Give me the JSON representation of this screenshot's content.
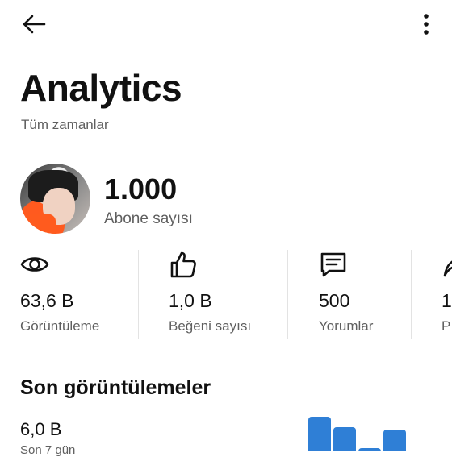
{
  "header": {
    "back_icon": "arrow-left-icon",
    "menu_icon": "more-vertical-icon"
  },
  "page": {
    "title": "Analytics",
    "subtitle": "Tüm zamanlar"
  },
  "channel": {
    "avatar": "profile-avatar",
    "subscriber_count": "1.000",
    "subscriber_label": "Abone sayısı"
  },
  "stats": [
    {
      "icon": "eye-icon",
      "value": "63,6 B",
      "label": "Görüntüleme"
    },
    {
      "icon": "thumbs-up-icon",
      "value": "1,0 B",
      "label": "Beğeni sayısı"
    },
    {
      "icon": "comment-icon",
      "value": "500",
      "label": "Yorumlar"
    },
    {
      "icon": "share-icon",
      "value": "1",
      "label": "P"
    }
  ],
  "recent": {
    "section_title": "Son görüntülemeler",
    "value": "6,0 B",
    "period": "Son 7 gün"
  },
  "colors": {
    "accent": "#2f7fd6",
    "text": "#111111",
    "muted": "#5f5f5f"
  }
}
